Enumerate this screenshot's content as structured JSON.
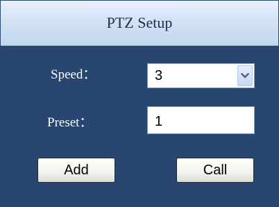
{
  "dialog": {
    "title": "PTZ Setup"
  },
  "form": {
    "speed_label": "Speed：",
    "speed_value": "3",
    "preset_label": "Preset：",
    "preset_value": "1"
  },
  "buttons": {
    "add_label": "Add",
    "call_label": "Call"
  },
  "icons": {
    "dropdown": "chevron-down-icon"
  },
  "colors": {
    "panel_background": "#28466f",
    "header_background": "#d3e3f5",
    "label_text": "#ffffff"
  }
}
